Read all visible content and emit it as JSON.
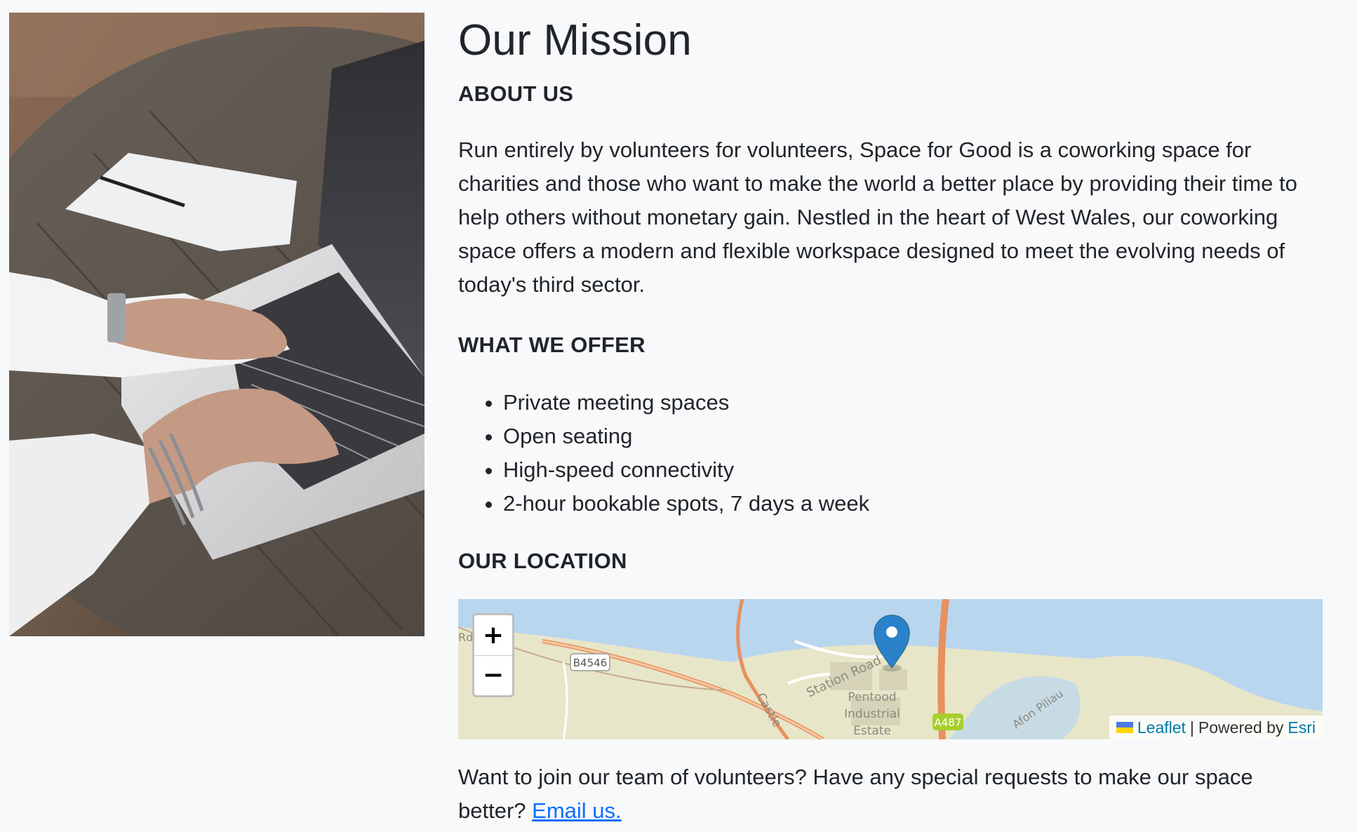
{
  "hero_image": {
    "alt": "",
    "icon": "laptop-photo"
  },
  "page_title": "Our Mission",
  "about": {
    "heading": "ABOUT US",
    "text": "Run entirely by volunteers for volunteers, Space for Good is a coworking space for charities and those who want to make the world a better place by providing their time to help others without monetary gain. Nestled in the heart of West Wales, our coworking space offers a modern and flexible workspace designed to meet the evolving needs of today's third sector."
  },
  "offer": {
    "heading": "WHAT WE OFFER",
    "items": [
      "Private meeting spaces",
      "Open seating",
      "High-speed connectivity",
      "2-hour bookable spots, 7 days a week"
    ]
  },
  "location": {
    "heading": "OUR LOCATION",
    "map": {
      "zoom_in": "+",
      "zoom_out": "−",
      "labels": {
        "road_b": "B4546",
        "road_a": "A487",
        "station_road": "Station Road",
        "castle": "Castle",
        "estate_line1": "Pentood",
        "estate_line2": "Industrial",
        "estate_line3": "Estate",
        "afon": "Afon Piliau",
        "rd": "Rd"
      },
      "attribution": {
        "leaflet": "Leaflet",
        "separator": "|",
        "powered_by": "Powered by",
        "esri": "Esri"
      },
      "colors": {
        "water": "#b9d6ef",
        "land": "#e8e6c8",
        "road_main": "#e8905e",
        "marker": "#2a82cb"
      }
    }
  },
  "footer": {
    "text": "Want to join our team of volunteers? Have any special requests to make our space better?",
    "link": "Email us."
  }
}
